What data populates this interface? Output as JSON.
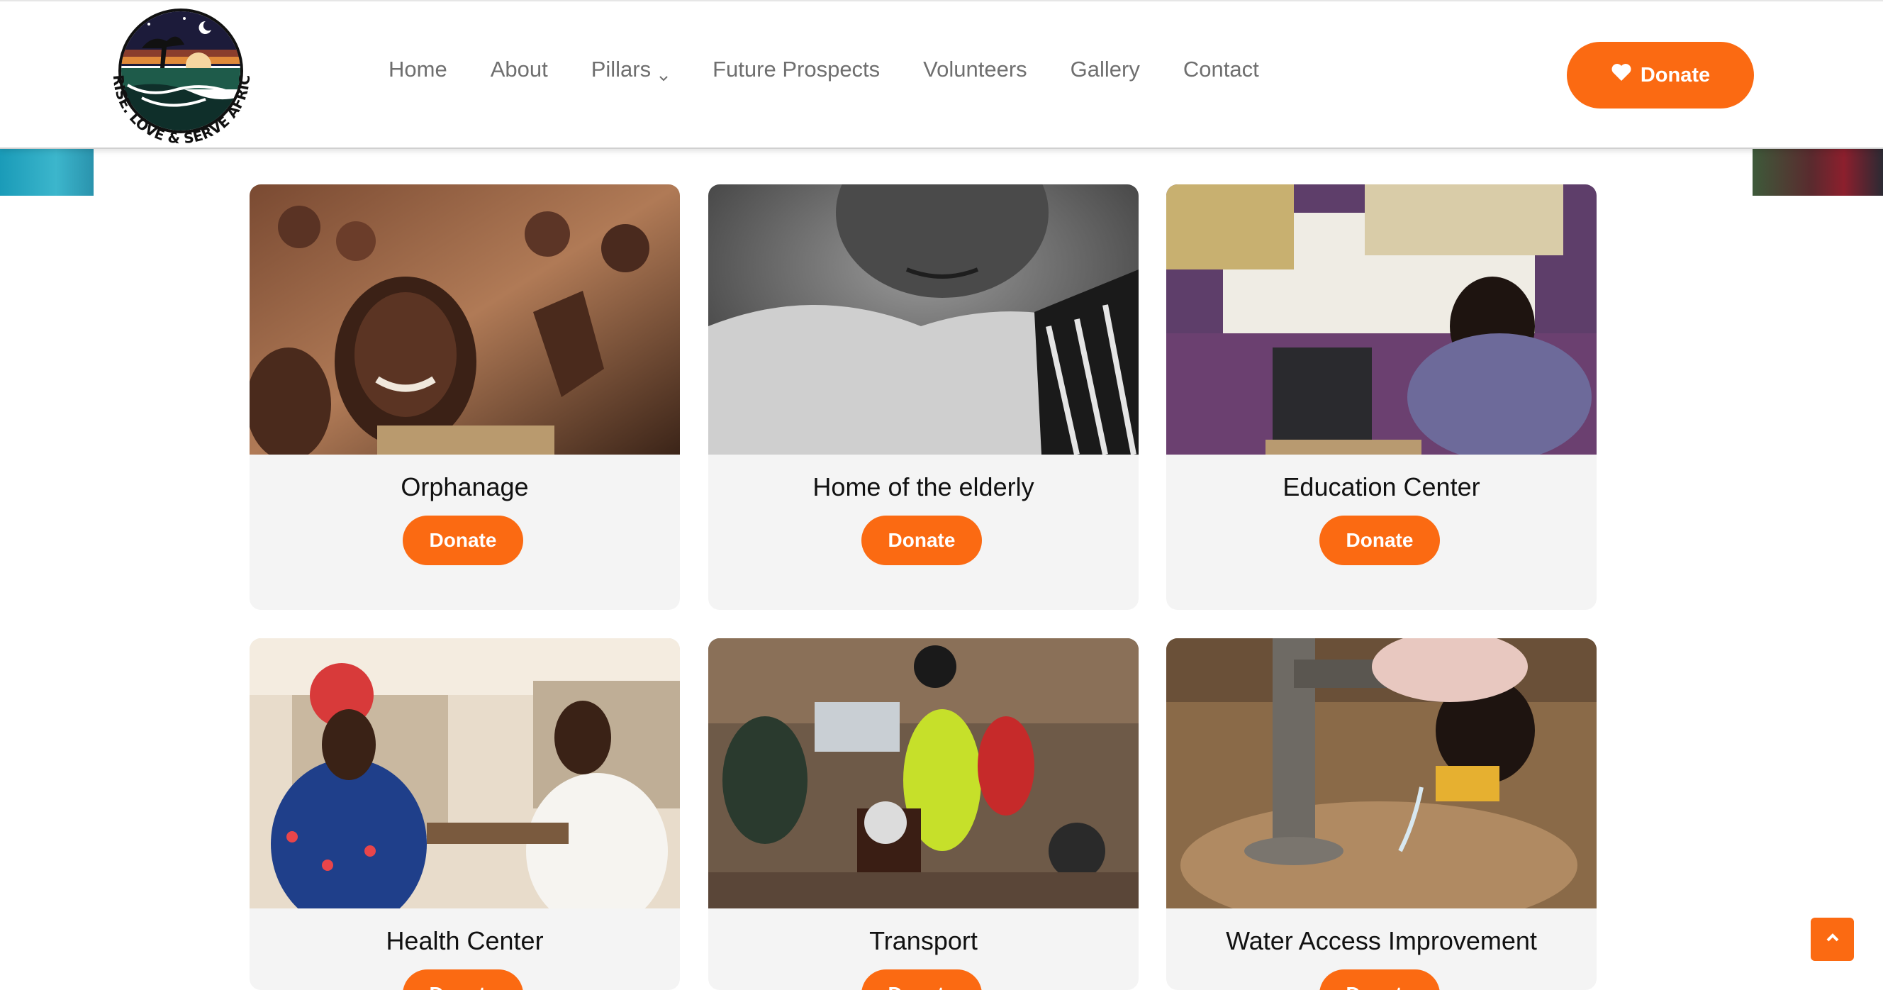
{
  "brand": {
    "logo_text": "ARISE. LOVE & SERVE AFRICA",
    "accent_color": "#fb6a12"
  },
  "nav": {
    "items": [
      {
        "label": "Home"
      },
      {
        "label": "About"
      },
      {
        "label": "Pillars",
        "has_dropdown": true
      },
      {
        "label": "Future Prospects"
      },
      {
        "label": "Volunteers"
      },
      {
        "label": "Gallery"
      },
      {
        "label": "Contact"
      }
    ],
    "donate_label": "Donate",
    "donate_icon": "heart-icon"
  },
  "cards": [
    {
      "title": "Orphanage",
      "button": "Donate",
      "photo": "children-smiling-photo"
    },
    {
      "title": "Home of the elderly",
      "button": "Donate",
      "photo": "elderly-woman-photo"
    },
    {
      "title": "Education Center",
      "button": "Donate",
      "photo": "boys-at-laptop-photo"
    },
    {
      "title": "Health Center",
      "button": "Donate",
      "photo": "blood-pressure-check-photo"
    },
    {
      "title": "Transport",
      "button": "Donate",
      "photo": "motorbike-street-photo"
    },
    {
      "title": "Water Access Improvement",
      "button": "Donate",
      "photo": "child-drinking-pump-photo"
    }
  ],
  "scroll_top_icon": "chevron-up-icon"
}
